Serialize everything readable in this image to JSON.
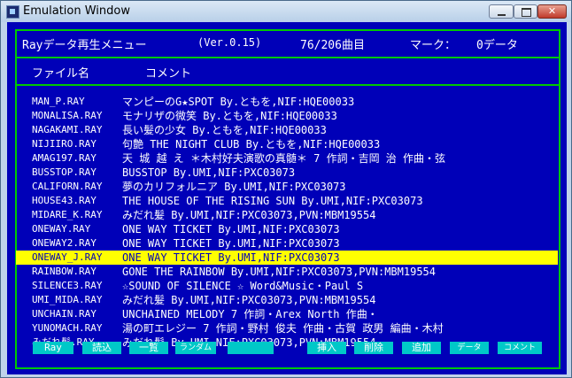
{
  "window": {
    "title": "Emulation Window",
    "close_glyph": "✕"
  },
  "header": {
    "app_title": "Rayデータ再生メニュー",
    "version": "(Ver.0.15)",
    "counter": "76/206曲目",
    "mark_label": "マーク：",
    "mark_value": "0データ"
  },
  "columns": {
    "file": "ファイル名",
    "comment": "コメント"
  },
  "rows": [
    {
      "file": "MAN_P.RAY",
      "comment": "マンピーのG★SPOT By.ともを,NIF:HQE00033"
    },
    {
      "file": "MONALISA.RAY",
      "comment": "モナリザの微笑 By.ともを,NIF:HQE00033"
    },
    {
      "file": "NAGAKAMI.RAY",
      "comment": "長い髪の少女 By.ともを,NIF:HQE00033"
    },
    {
      "file": "NIJIIRO.RAY",
      "comment": "句艶 THE NIGHT CLUB By.ともを,NIF:HQE00033"
    },
    {
      "file": "AMAG197.RAY",
      "comment": "天 城 越 え ＊木村好夫演歌の真髄＊ 7 作詞・吉岡 治 作曲・弦"
    },
    {
      "file": "BUSSTOP.RAY",
      "comment": "BUSSTOP By.UMI,NIF:PXC03073"
    },
    {
      "file": "CALIFORN.RAY",
      "comment": "夢のカリフォルニア By.UMI,NIF:PXC03073"
    },
    {
      "file": "HOUSE43.RAY",
      "comment": "THE HOUSE OF THE RISING SUN By.UMI,NIF:PXC03073"
    },
    {
      "file": "MIDARE_K.RAY",
      "comment": "みだれ髪 By.UMI,NIF:PXC03073,PVN:MBM19554"
    },
    {
      "file": "ONEWAY.RAY",
      "comment": "ONE WAY TICKET By.UMI,NIF:PXC03073"
    },
    {
      "file": "ONEWAY2.RAY",
      "comment": "ONE WAY TICKET By.UMI,NIF:PXC03073"
    },
    {
      "file": "ONEWAY_J.RAY",
      "comment": "ONE WAY TICKET By.UMI,NIF:PXC03073",
      "selected": true
    },
    {
      "file": "RAINBOW.RAY",
      "comment": "GONE THE RAINBOW By.UMI,NIF:PXC03073,PVN:MBM19554"
    },
    {
      "file": "SILENCE3.RAY",
      "comment": "☆SOUND OF SILENCE ☆ Word&Music・Paul S"
    },
    {
      "file": "UMI_MIDA.RAY",
      "comment": "みだれ髪 By.UMI,NIF:PXC03073,PVN:MBM19554"
    },
    {
      "file": "UNCHAIN.RAY",
      "comment": "UNCHAINED MELODY 7 作詞・Arex North 作曲・"
    },
    {
      "file": "YUNOMACH.RAY",
      "comment": "湯の町エレジー 7 作詞・野村 俊夫 作曲・古賀 政男 編曲・木村"
    },
    {
      "file": "みだれ髪.RAY",
      "comment": "みだれ髪 By.UMI,NIF:PXC03073,PVN:MBM19554"
    }
  ],
  "fkeys": [
    {
      "label": "Ray"
    },
    {
      "label": "読込"
    },
    {
      "label": "一覧"
    },
    {
      "label": "ランダム"
    },
    {
      "label": ""
    },
    {
      "label": "挿入"
    },
    {
      "label": "削除"
    },
    {
      "label": "追加"
    },
    {
      "label": "データ"
    },
    {
      "label": "コメント"
    }
  ],
  "colors": {
    "screen_bg": "#0000b8",
    "frame": "#00c800",
    "text": "#ffffff",
    "selection_bg": "#ffff00",
    "selection_text": "#0000b8",
    "fkey_bg": "#00c8c8"
  }
}
